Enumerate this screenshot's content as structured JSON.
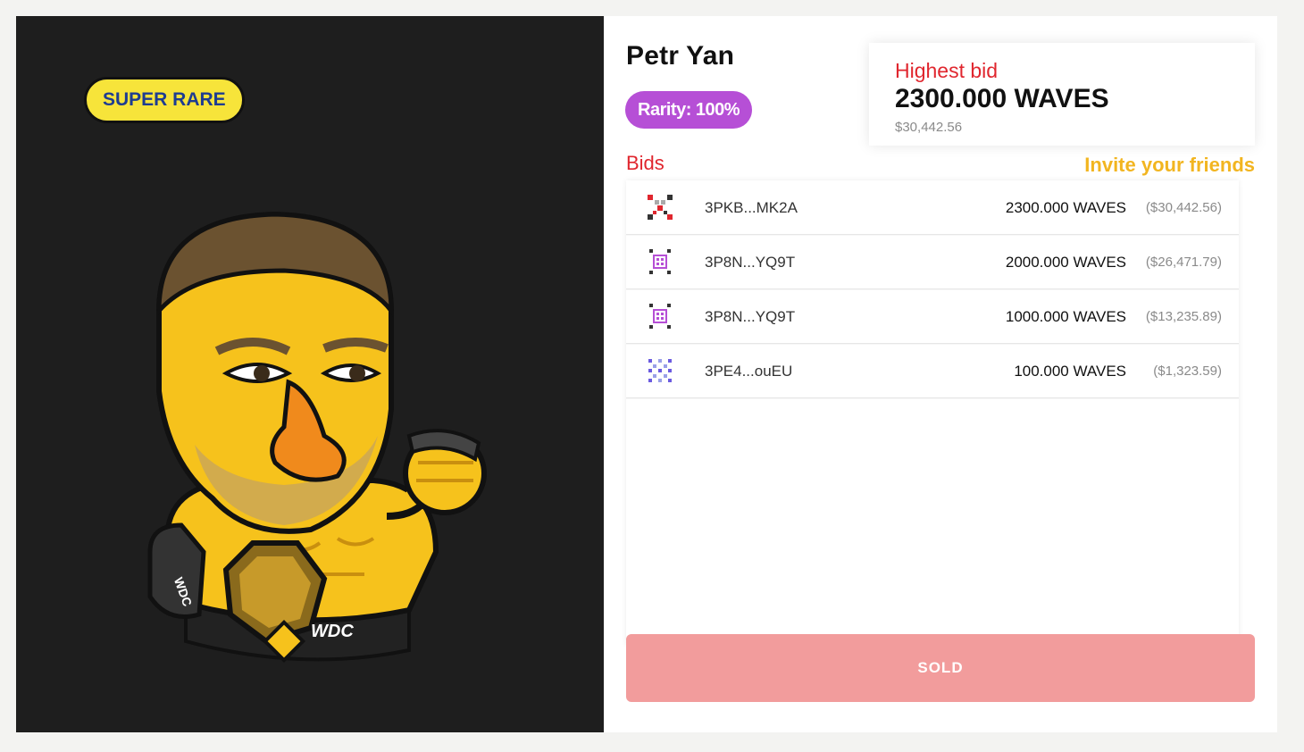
{
  "artwork": {
    "badge": "SUPER RARE",
    "belt_text": "WDC",
    "glove_text": "WDC"
  },
  "nft": {
    "name": "Petr Yan",
    "rarity": "Rarity: 100%"
  },
  "highest_bid": {
    "label": "Highest bid",
    "amount": "2300.000 WAVES",
    "usd": "$30,442.56"
  },
  "bids": {
    "heading": "Bids",
    "invite_label": "Invite your friends",
    "items": [
      {
        "address": "3PKB...MK2A",
        "amount": "2300.000 WAVES",
        "usd": "($30,442.56)",
        "identicon_color": "#e0262e"
      },
      {
        "address": "3P8N...YQ9T",
        "amount": "2000.000 WAVES",
        "usd": "($26,471.79)",
        "identicon_color": "#b64fd6"
      },
      {
        "address": "3P8N...YQ9T",
        "amount": "1000.000 WAVES",
        "usd": "($13,235.89)",
        "identicon_color": "#b64fd6"
      },
      {
        "address": "3PE4...ouEU",
        "amount": "100.000 WAVES",
        "usd": "($1,323.59)",
        "identicon_color": "#6b5be0"
      }
    ]
  },
  "action": {
    "label": "SOLD"
  },
  "colors": {
    "accent_red": "#e0262e",
    "rarity_purple": "#b64fd6",
    "invite_yellow": "#f2b520",
    "sold_button": "#f29c9c",
    "badge_yellow": "#f7e43a"
  }
}
